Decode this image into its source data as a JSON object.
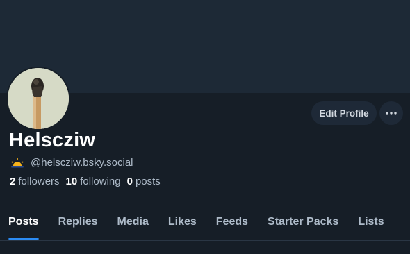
{
  "profile": {
    "display_name": "Helscziw",
    "handle": "@helscziw.bsky.social",
    "handle_emoji_icon": "sunrise-icon",
    "stats": {
      "followers_count": "2",
      "followers_label": "followers",
      "following_count": "10",
      "following_label": "following",
      "posts_count": "0",
      "posts_label": "posts"
    }
  },
  "actions": {
    "edit_profile_label": "Edit Profile",
    "more_icon": "ellipsis-icon"
  },
  "tabs": [
    {
      "label": "Posts",
      "active": true
    },
    {
      "label": "Replies",
      "active": false
    },
    {
      "label": "Media",
      "active": false
    },
    {
      "label": "Likes",
      "active": false
    },
    {
      "label": "Feeds",
      "active": false
    },
    {
      "label": "Starter Packs",
      "active": false
    },
    {
      "label": "Lists",
      "active": false
    }
  ],
  "colors": {
    "background": "#161e27",
    "banner": "#1d2936",
    "accent": "#2c8cf4",
    "muted_text": "#aebbc9"
  }
}
